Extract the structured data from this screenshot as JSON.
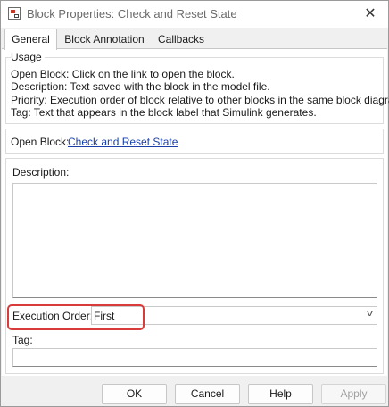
{
  "window": {
    "title": "Block Properties: Check and Reset State"
  },
  "icons": {
    "app": "simulink-block-icon",
    "close": "close-icon",
    "dropdown": "chevron-down-icon"
  },
  "tabs": [
    {
      "label": "General",
      "active": true
    },
    {
      "label": "Block Annotation",
      "active": false
    },
    {
      "label": "Callbacks",
      "active": false
    }
  ],
  "usage": {
    "title": "Usage",
    "lines": [
      "Open Block: Click on the link to open the block.",
      "Description: Text saved with the block in the model file.",
      "Priority: Execution order of block relative to other blocks in the same block diagram.",
      "Tag: Text that appears in the block label that Simulink generates."
    ]
  },
  "open_block": {
    "label": "Open Block:",
    "link": "Check and Reset State"
  },
  "description": {
    "label": "Description:",
    "value": ""
  },
  "execution_order": {
    "label": "Execution Order:",
    "value": "First"
  },
  "tag": {
    "label": "Tag:",
    "value": ""
  },
  "buttons": {
    "ok": "OK",
    "cancel": "Cancel",
    "help": "Help",
    "apply": "Apply"
  },
  "colors": {
    "highlight": "#d93a3a",
    "link": "#1a3fa8"
  }
}
